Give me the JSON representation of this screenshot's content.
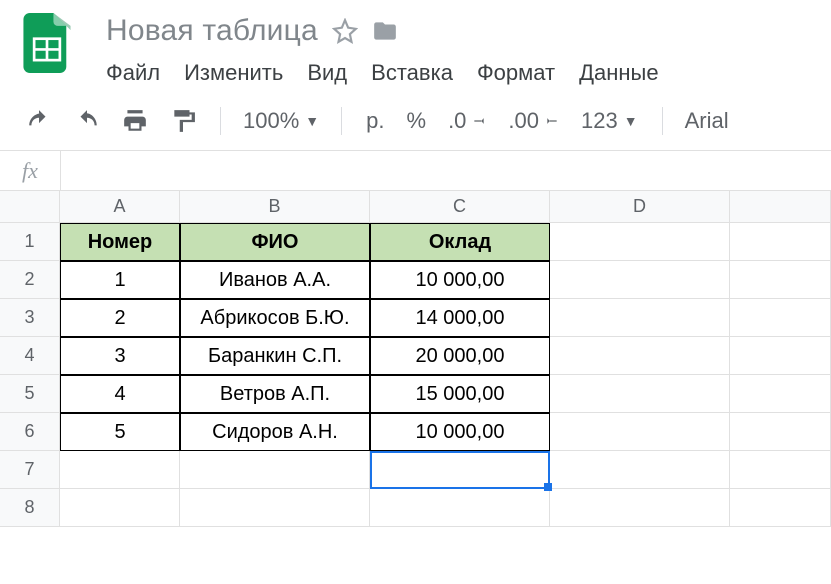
{
  "header": {
    "doc_title": "Новая таблица"
  },
  "menu": {
    "file": "Файл",
    "edit": "Изменить",
    "view": "Вид",
    "insert": "Вставка",
    "format": "Формат",
    "data": "Данные"
  },
  "toolbar": {
    "zoom": "100%",
    "currency": "р.",
    "percent": "%",
    "dec_less": ".0",
    "dec_more": ".00",
    "num_fmt": "123",
    "font": "Arial"
  },
  "formula": {
    "label": "fx",
    "value": ""
  },
  "columns": [
    "A",
    "B",
    "C",
    "D"
  ],
  "rows": [
    "1",
    "2",
    "3",
    "4",
    "5",
    "6",
    "7",
    "8"
  ],
  "selected_cell": "C7",
  "chart_data": {
    "type": "table",
    "header_fill": "#c5e0b3",
    "columns": [
      "Номер",
      "ФИО",
      "Оклад"
    ],
    "rows": [
      [
        "1",
        "Иванов А.А.",
        "10 000,00"
      ],
      [
        "2",
        "Абрикосов Б.Ю.",
        "14 000,00"
      ],
      [
        "3",
        "Баранкин С.П.",
        "20 000,00"
      ],
      [
        "4",
        "Ветров А.П.",
        "15 000,00"
      ],
      [
        "5",
        "Сидоров А.Н.",
        "10 000,00"
      ]
    ]
  }
}
